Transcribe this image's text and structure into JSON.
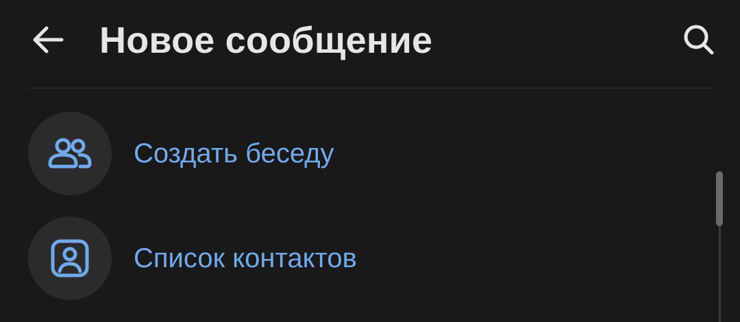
{
  "header": {
    "title": "Новое сообщение",
    "back_icon": "arrow-left-icon",
    "search_icon": "search-icon"
  },
  "menu": {
    "items": [
      {
        "label": "Создать беседу",
        "icon": "group-icon"
      },
      {
        "label": "Список контактов",
        "icon": "contact-card-icon"
      }
    ]
  },
  "colors": {
    "background": "#191919",
    "title": "#e6e6e6",
    "accent": "#71aaeb",
    "icon_circle": "#2b2b2d",
    "divider": "#333333"
  }
}
